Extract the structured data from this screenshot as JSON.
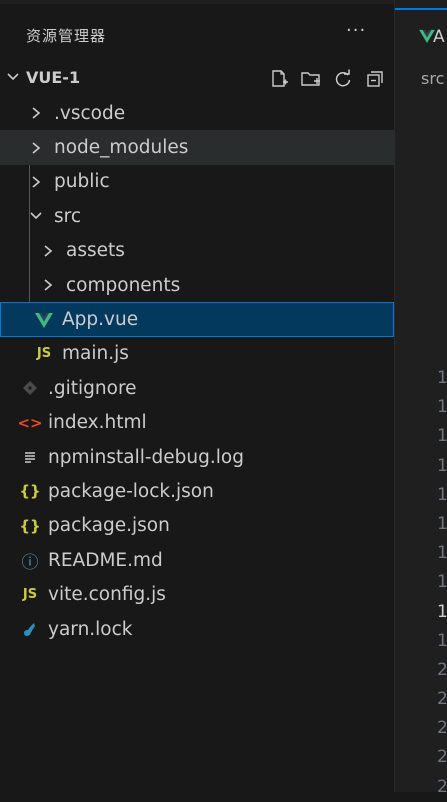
{
  "explorer": {
    "title": "资源管理器",
    "more": "···",
    "root": "VUE-1",
    "actions": [
      "new-file-icon",
      "new-folder-icon",
      "refresh-icon",
      "collapse-all-icon"
    ]
  },
  "tree": {
    "vscode": ".vscode",
    "node_modules": "node_modules",
    "public": "public",
    "src": "src",
    "assets": "assets",
    "components": "components",
    "app_vue": "App.vue",
    "main_js": "main.js",
    "gitignore": ".gitignore",
    "index_html": "index.html",
    "npm_log": "npminstall-debug.log",
    "package_lock": "package-lock.json",
    "package_json": "package.json",
    "readme": "README.md",
    "vite_config": "vite.config.js",
    "yarn_lock": "yarn.lock"
  },
  "icons": {
    "js_label": "JS",
    "braces": "{}",
    "html": "<>",
    "info": "ⓘ"
  },
  "editor": {
    "tab_text": "A",
    "breadcrumb": "src",
    "line_numbers": [
      "1",
      "1",
      "1",
      "1",
      "1",
      "1",
      "1",
      "1",
      "1",
      "1",
      "2",
      "2",
      "2",
      "2",
      "2"
    ],
    "active_line_index": 8
  },
  "colors": {
    "vue": "#41b883",
    "js": "#cbcb41",
    "json": "#cbcb41",
    "html": "#e44d26",
    "info": "#519aba",
    "selection": "#04395e",
    "focus_border": "#0078d4"
  }
}
